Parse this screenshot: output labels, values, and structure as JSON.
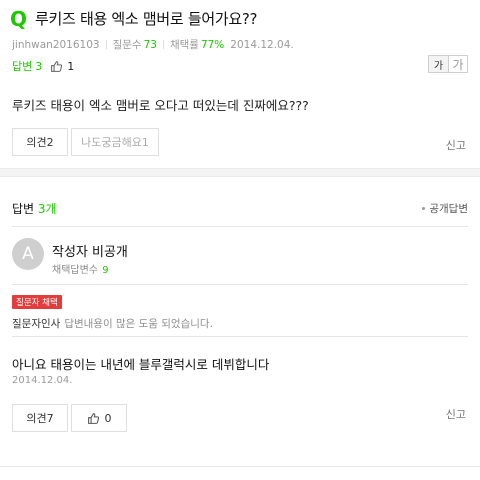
{
  "question": {
    "icon": "Q",
    "title": "루키즈 태용 엑소 맴버로 들어가요??",
    "author": "jinhwan2016103",
    "question_count_label": "질문수",
    "question_count": "73",
    "adopt_rate_label": "채택률",
    "adopt_rate": "77%",
    "date": "2014.12.04.",
    "answer_label": "답변",
    "answer_count": "3",
    "like_count": "1",
    "font_small": "가",
    "font_large": "가",
    "body": "루키즈 태용이 엑소 맴버로 오다고 떠있는데 진짜에요???",
    "opinion_button": "의견2",
    "curious_button": "나도궁금해요1",
    "report": "신고"
  },
  "answers_section": {
    "label": "답변",
    "count": "3개",
    "public_answer_link": "공개답변"
  },
  "answer": {
    "avatar_letter": "A",
    "author": "작성자 비공개",
    "adopt_count_label": "채택답변수",
    "adopt_count": "9",
    "badge": "질문자 채택",
    "thanks_label": "질문자인사",
    "thanks_text": "답변내용이 많은 도움 되었습니다.",
    "body": "아니요 태용이는 내년에 블루갤럭시로 데뷔합니다",
    "date": "2014.12.04.",
    "opinion_button": "의견7",
    "like_count": "0",
    "report": "신고"
  },
  "colors": {
    "accent_green": "#1ec800",
    "badge_red": "#e33c3c",
    "divider": "#e5e5e5"
  },
  "icons": {
    "question": "q-icon",
    "thumbs_up": "thumbs-up-icon",
    "avatar": "avatar-placeholder",
    "dot": "bullet-icon"
  }
}
